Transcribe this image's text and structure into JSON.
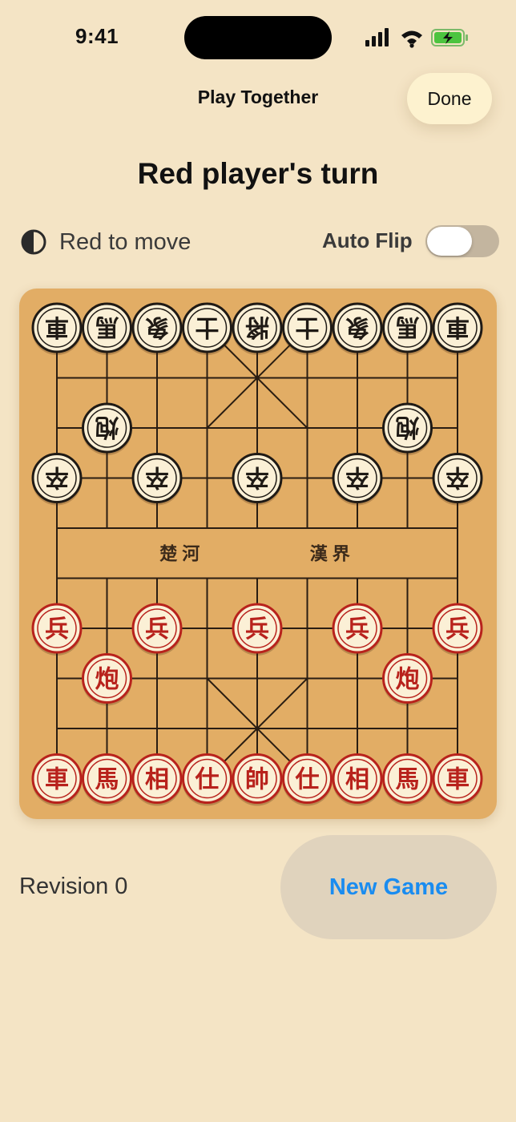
{
  "status_bar": {
    "time": "9:41"
  },
  "nav": {
    "title": "Play Together",
    "done_label": "Done"
  },
  "game": {
    "turn_title": "Red player's turn",
    "move_status": "Red to move",
    "auto_flip_label": "Auto Flip",
    "auto_flip_on": false,
    "revision_label": "Revision 0",
    "new_game_label": "New Game"
  },
  "board": {
    "columns": 9,
    "rows": 10,
    "river_left": "楚河",
    "river_right": "漢界",
    "pieces": [
      {
        "side": "black",
        "char": "車",
        "col": 0,
        "row": 0
      },
      {
        "side": "black",
        "char": "馬",
        "col": 1,
        "row": 0
      },
      {
        "side": "black",
        "char": "象",
        "col": 2,
        "row": 0
      },
      {
        "side": "black",
        "char": "士",
        "col": 3,
        "row": 0
      },
      {
        "side": "black",
        "char": "將",
        "col": 4,
        "row": 0
      },
      {
        "side": "black",
        "char": "士",
        "col": 5,
        "row": 0
      },
      {
        "side": "black",
        "char": "象",
        "col": 6,
        "row": 0
      },
      {
        "side": "black",
        "char": "馬",
        "col": 7,
        "row": 0
      },
      {
        "side": "black",
        "char": "車",
        "col": 8,
        "row": 0
      },
      {
        "side": "black",
        "char": "炮",
        "col": 1,
        "row": 2
      },
      {
        "side": "black",
        "char": "炮",
        "col": 7,
        "row": 2
      },
      {
        "side": "black",
        "char": "卒",
        "col": 0,
        "row": 3
      },
      {
        "side": "black",
        "char": "卒",
        "col": 2,
        "row": 3
      },
      {
        "side": "black",
        "char": "卒",
        "col": 4,
        "row": 3
      },
      {
        "side": "black",
        "char": "卒",
        "col": 6,
        "row": 3
      },
      {
        "side": "black",
        "char": "卒",
        "col": 8,
        "row": 3
      },
      {
        "side": "red",
        "char": "兵",
        "col": 0,
        "row": 6
      },
      {
        "side": "red",
        "char": "兵",
        "col": 2,
        "row": 6
      },
      {
        "side": "red",
        "char": "兵",
        "col": 4,
        "row": 6
      },
      {
        "side": "red",
        "char": "兵",
        "col": 6,
        "row": 6
      },
      {
        "side": "red",
        "char": "兵",
        "col": 8,
        "row": 6
      },
      {
        "side": "red",
        "char": "炮",
        "col": 1,
        "row": 7
      },
      {
        "side": "red",
        "char": "炮",
        "col": 7,
        "row": 7
      },
      {
        "side": "red",
        "char": "車",
        "col": 0,
        "row": 9
      },
      {
        "side": "red",
        "char": "馬",
        "col": 1,
        "row": 9
      },
      {
        "side": "red",
        "char": "相",
        "col": 2,
        "row": 9
      },
      {
        "side": "red",
        "char": "仕",
        "col": 3,
        "row": 9
      },
      {
        "side": "red",
        "char": "帥",
        "col": 4,
        "row": 9
      },
      {
        "side": "red",
        "char": "仕",
        "col": 5,
        "row": 9
      },
      {
        "side": "red",
        "char": "相",
        "col": 6,
        "row": 9
      },
      {
        "side": "red",
        "char": "馬",
        "col": 7,
        "row": 9
      },
      {
        "side": "red",
        "char": "車",
        "col": 8,
        "row": 9
      }
    ]
  },
  "colors": {
    "background": "#f4e4c5",
    "board": "#e2ad65",
    "grid_line": "#2a1d12",
    "red_piece": "#b8221c",
    "black_piece": "#1f1a15",
    "piece_face": "#fbf0d6",
    "accent_blue": "#1a8cf0"
  }
}
